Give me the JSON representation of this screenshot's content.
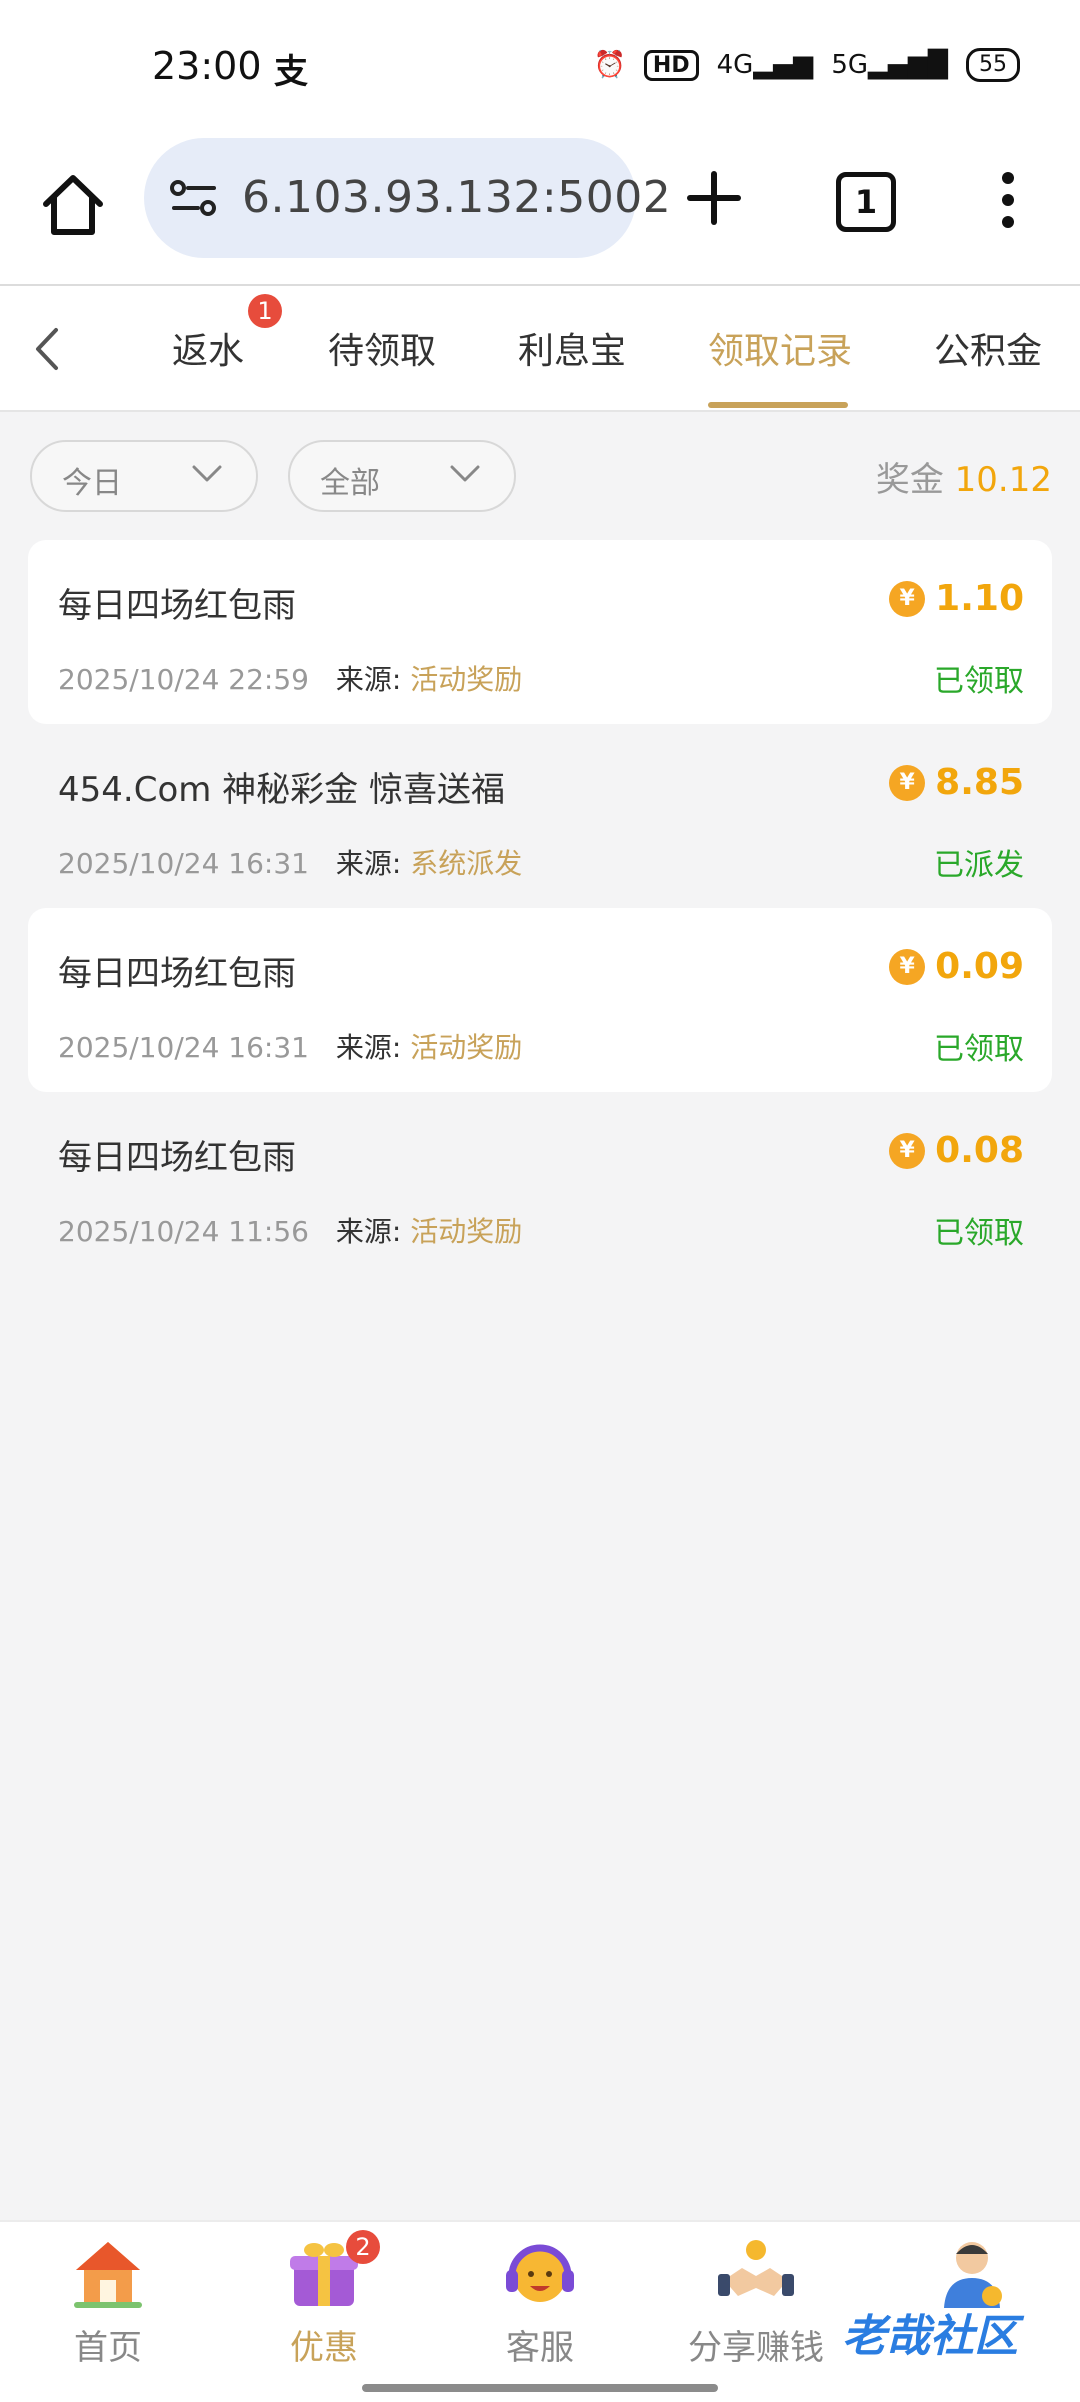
{
  "status_bar": {
    "time": "23:00",
    "alipay_glyph": "支",
    "hd_badge": "HD",
    "network_4g": "4G",
    "network_5g": "5G",
    "battery": "55"
  },
  "browser": {
    "url": "6.103.93.132:5002",
    "tab_count": "1"
  },
  "tabs": [
    {
      "label": "返水",
      "badge": "1"
    },
    {
      "label": "待领取"
    },
    {
      "label": "利息宝"
    },
    {
      "label": "领取记录",
      "active": true
    },
    {
      "label": "公积金"
    }
  ],
  "filters": {
    "date": "今日",
    "type": "全部",
    "bonus_label": "奖金",
    "bonus_value": "10.12"
  },
  "records": [
    {
      "title": "每日四场红包雨",
      "amount": "1.10",
      "datetime": "2025/10/24 22:59",
      "source_label": "来源:",
      "source": "活动奖励",
      "status": "已领取"
    },
    {
      "title": "454.Com 神秘彩金 惊喜送福",
      "amount": "8.85",
      "datetime": "2025/10/24 16:31",
      "source_label": "来源:",
      "source": "系统派发",
      "status": "已派发"
    },
    {
      "title": "每日四场红包雨",
      "amount": "0.09",
      "datetime": "2025/10/24 16:31",
      "source_label": "来源:",
      "source": "活动奖励",
      "status": "已领取"
    },
    {
      "title": "每日四场红包雨",
      "amount": "0.08",
      "datetime": "2025/10/24 11:56",
      "source_label": "来源:",
      "source": "活动奖励",
      "status": "已领取"
    }
  ],
  "coin_symbol": "¥",
  "bottom_nav": [
    {
      "label": "首页",
      "icon": "house-icon"
    },
    {
      "label": "优惠",
      "icon": "gift-icon",
      "badge": "2",
      "active": true
    },
    {
      "label": "客服",
      "icon": "headset-icon"
    },
    {
      "label": "分享赚钱",
      "icon": "handshake-icon"
    },
    {
      "label": "",
      "icon": "profile-icon"
    }
  ],
  "watermark": "老哉社区",
  "colors": {
    "accent_gold": "#c8a259",
    "amount_orange": "#f2a60c",
    "status_green": "#2aa82a",
    "badge_red": "#e74c3c",
    "page_bg": "#f4f4f5"
  }
}
